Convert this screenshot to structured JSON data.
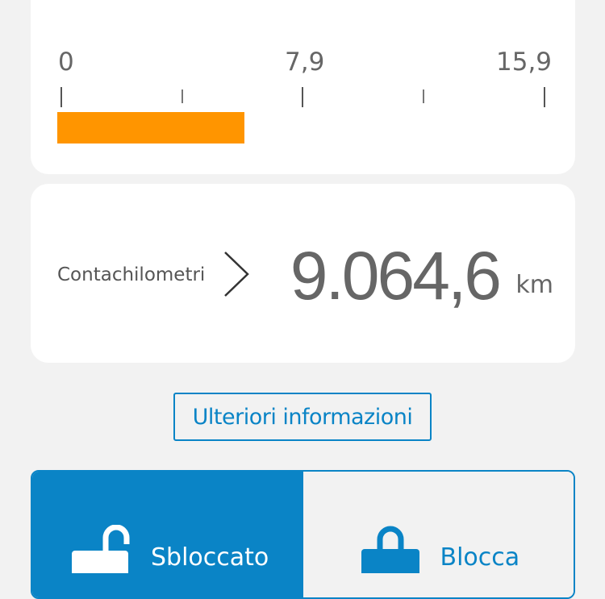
{
  "gauge": {
    "scale_labels": [
      "0",
      "7,9",
      "15,9"
    ],
    "scale_min": 0,
    "scale_max": 15.9,
    "level": 6.1,
    "bar_color": "#ff9500"
  },
  "odometer": {
    "label": "Contachilometri",
    "value": "9.064,6",
    "unit": "km",
    "icon": "chevron-right-icon"
  },
  "more_info": {
    "label": "Ulteriori informazioni"
  },
  "lock_control": {
    "options": [
      {
        "label": "Sbloccato",
        "icon": "unlocked-icon",
        "selected": true
      },
      {
        "label": "Blocca",
        "icon": "lock-icon",
        "selected": false
      }
    ],
    "accent_color": "#0a84c6"
  }
}
